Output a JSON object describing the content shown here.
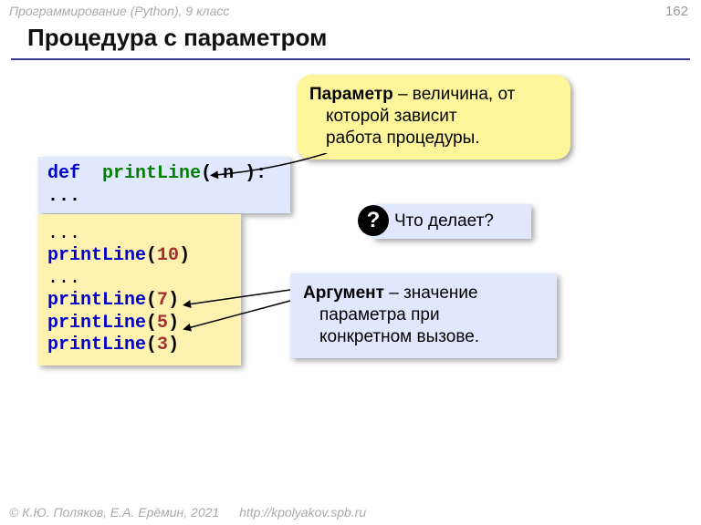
{
  "header": "Программирование (Python), 9 класс",
  "pageNumber": "162",
  "title": "Процедура с параметром",
  "calloutParameter": {
    "term": "Параметр",
    "rest1": " – величина, от",
    "line2": "которой зависит",
    "line3": "работа процедуры."
  },
  "codeDef": {
    "kw": "def",
    "fn": "printLine",
    "args": "( n ):",
    "ellipsis": " ..."
  },
  "codeBody": {
    "call": "printLine",
    "ell": "...",
    "nums": [
      "10",
      "7",
      "5",
      "3"
    ]
  },
  "question": {
    "symbol": "?",
    "text": "Что делает?"
  },
  "calloutArgument": {
    "term": "Аргумент",
    "rest1": " – значение",
    "line2": "параметра при",
    "line3": "конкретном вызове."
  },
  "footer": {
    "authors": "© К.Ю. Поляков, Е.А. Ерёмин, 2021",
    "url": "http://kpolyakov.spb.ru"
  }
}
